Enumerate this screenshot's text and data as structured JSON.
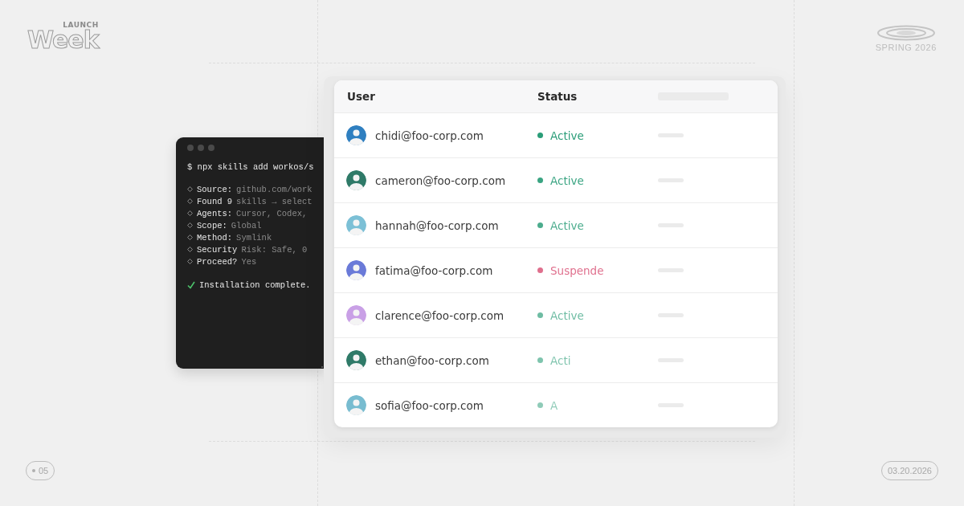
{
  "brand": {
    "small": "LAUNCH",
    "big": "Week"
  },
  "edition": {
    "label": "SPRING 2026"
  },
  "terminal": {
    "command": "$ npx skills add workos/s",
    "lines": [
      {
        "kind": "step",
        "label": "Source:",
        "value": "github.com/work"
      },
      {
        "kind": "step",
        "label": "Found 9",
        "value": "skills → select"
      },
      {
        "kind": "step",
        "label": "Agents:",
        "value": "Cursor, Codex,"
      },
      {
        "kind": "step",
        "label": "Scope:",
        "value": "Global"
      },
      {
        "kind": "step",
        "label": "Method:",
        "value": "Symlink"
      },
      {
        "kind": "step",
        "label": "Security",
        "value": "Risk: Safe, 0"
      },
      {
        "kind": "step",
        "label": "Proceed?",
        "value": "Yes"
      },
      {
        "kind": "done",
        "label": "Installation complete."
      }
    ]
  },
  "table": {
    "columns": [
      "User",
      "Status"
    ],
    "rows": [
      {
        "email": "chidi@foo-corp.com",
        "color": "#2f7fc0",
        "status": {
          "kind": "active",
          "label": "Active"
        }
      },
      {
        "email": "cameron@foo-corp.com",
        "color": "#2f7a68",
        "status": {
          "kind": "active",
          "label": "Active"
        }
      },
      {
        "email": "hannah@foo-corp.com",
        "color": "#7cc0d6",
        "status": {
          "kind": "active",
          "label": "Active"
        }
      },
      {
        "email": "fatima@foo-corp.com",
        "color": "#6a7ad8",
        "status": {
          "kind": "suspended",
          "label": "Suspende"
        }
      },
      {
        "email": "clarence@foo-corp.com",
        "color": "#c9a0e6",
        "status": {
          "kind": "active",
          "label": "Active"
        }
      },
      {
        "email": "ethan@foo-corp.com",
        "color": "#2f7a68",
        "status": {
          "kind": "active",
          "label": "Acti"
        }
      },
      {
        "email": "sofia@foo-corp.com",
        "color": "#78bcd0",
        "status": {
          "kind": "active",
          "label": "A"
        }
      }
    ]
  },
  "footer": {
    "episode": "05",
    "date": "03.20.2026"
  }
}
